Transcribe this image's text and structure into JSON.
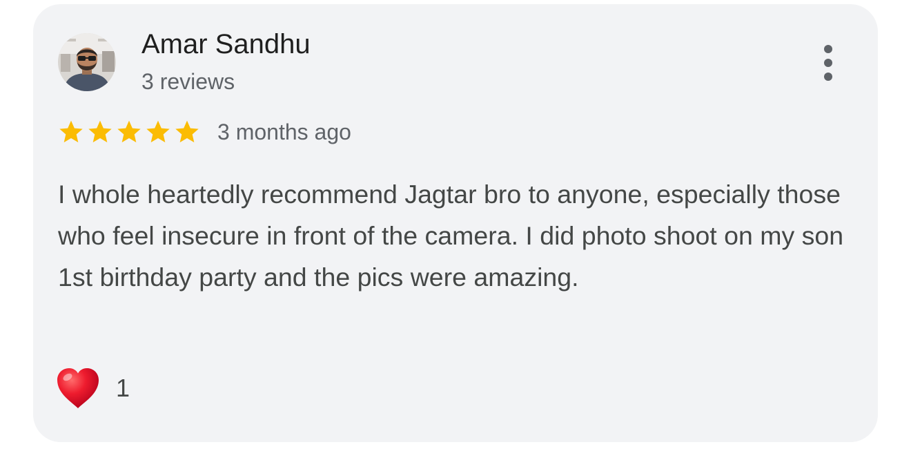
{
  "review": {
    "reviewer_name": "Amar Sandhu",
    "reviewer_reviews": "3 reviews",
    "rating": 5,
    "rating_max": 5,
    "date": "3 months ago",
    "text": "I whole heartedly recommend Jagtar bro to anyone, especially those who feel insecure in front of the camera. I did photo shoot on my son 1st birthday party and the pics were amazing.",
    "reaction_icon": "heart-icon",
    "reaction_count": "1"
  },
  "icons": {
    "menu": "more-vert-icon",
    "star": "star-icon"
  },
  "colors": {
    "card_background": "#f2f3f5",
    "star": "#fbbc04",
    "heart": "#e3132b",
    "name_text": "#1f1f1f",
    "secondary_text": "#5f6368",
    "body_text": "#444746"
  }
}
